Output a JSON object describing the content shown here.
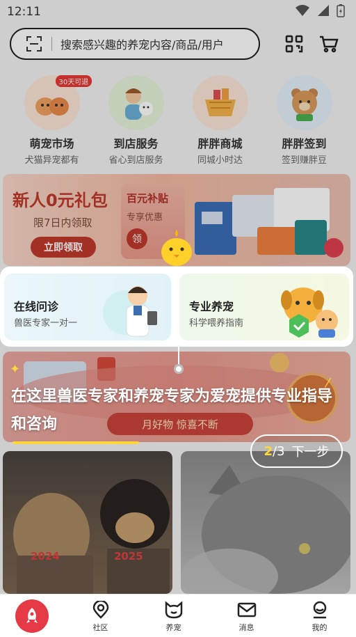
{
  "status": {
    "time": "12:11"
  },
  "search": {
    "placeholder": "搜索感兴趣的养宠内容/商品/用户"
  },
  "quick_nav": [
    {
      "title": "萌宠市场",
      "sub": "犬猫异宠都有",
      "badge": "30天可退",
      "icon": "puppy-kitten-icon"
    },
    {
      "title": "到店服务",
      "sub": "省心到店服务",
      "icon": "groomer-icon"
    },
    {
      "title": "胖胖商城",
      "sub": "同城小时达",
      "icon": "shopping-basket-icon"
    },
    {
      "title": "胖胖签到",
      "sub": "签到赚胖豆",
      "icon": "bear-mascot-icon"
    }
  ],
  "promo": {
    "title": "新人0元礼包",
    "sub": "限7日内领取",
    "button": "立即领取",
    "mid_title": "百元补贴",
    "mid_sub": "专享优惠",
    "mid_circle": "领"
  },
  "spotlight": [
    {
      "title": "在线问诊",
      "sub": "兽医专家一对一",
      "icon": "vet-doctor-icon"
    },
    {
      "title": "专业养宠",
      "sub": "科学喂养指南",
      "icon": "dog-cat-shield-icon"
    }
  ],
  "banner2": {
    "ribbon": "月好物 惊喜不断"
  },
  "guide": {
    "text": "在这里兽医专家和养宠专家为爱宠提供专业指导和咨询",
    "step_current": "2",
    "step_total": "/3",
    "next_label": "下一步"
  },
  "feed": [
    {
      "tags": [
        "2024",
        "2025"
      ]
    },
    {
      "tags": []
    }
  ],
  "tabbar": [
    {
      "label": "",
      "icon": "rocket-icon"
    },
    {
      "label": "社区",
      "icon": "community-icon"
    },
    {
      "label": "养宠",
      "icon": "cat-face-icon"
    },
    {
      "label": "消息",
      "icon": "mail-icon"
    },
    {
      "label": "我的",
      "icon": "profile-icon"
    }
  ],
  "colors": {
    "accent": "#e53945",
    "highlight": "#ffd63a",
    "promo_red": "#c0392b"
  }
}
